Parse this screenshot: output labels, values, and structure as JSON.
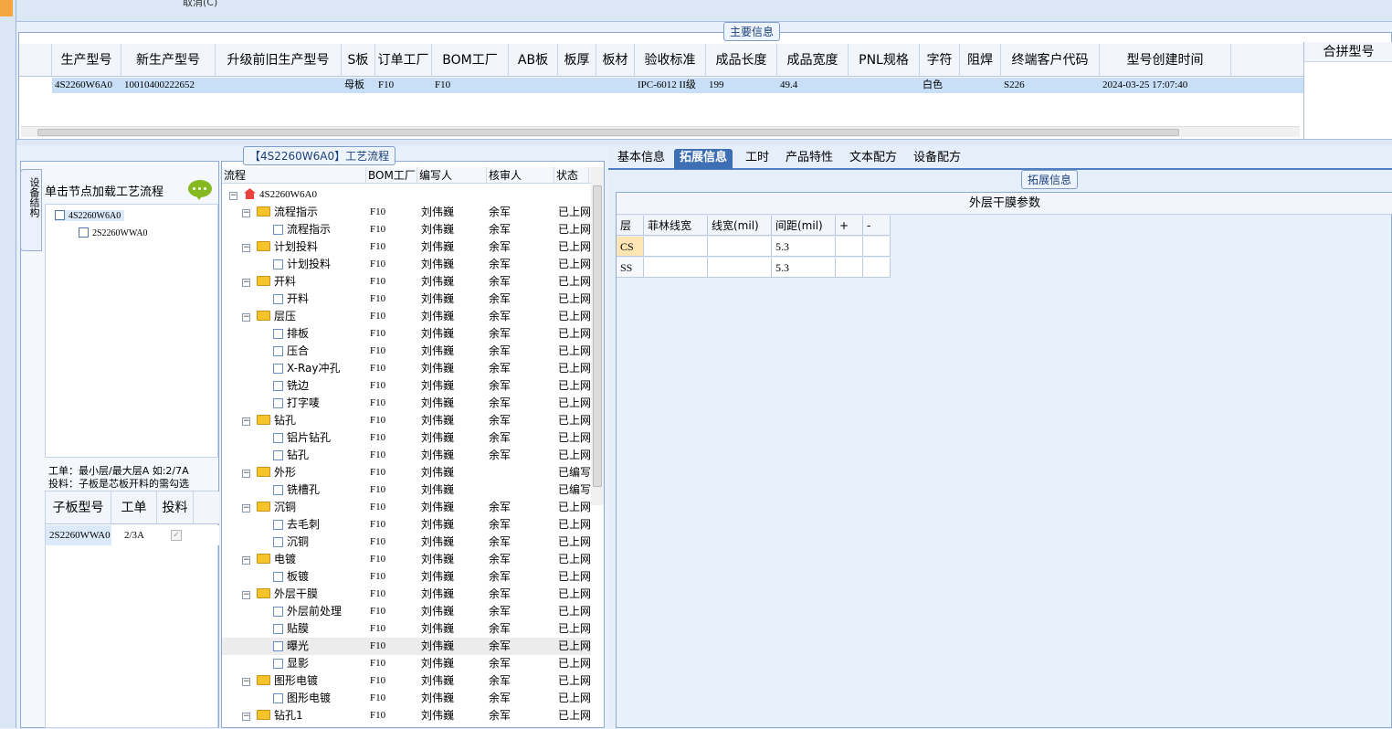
{
  "top": {
    "cancel_label": "取消(C)"
  },
  "main_info": {
    "group_title": "主要信息",
    "columns": [
      "生产型号",
      "新生产型号",
      "升级前旧生产型号",
      "S板",
      "订单工厂",
      "BOM工厂",
      "AB板",
      "板厚",
      "板材",
      "验收标准",
      "成品长度",
      "成品宽度",
      "PNL规格",
      "字符",
      "阻焊",
      "终端客户代码",
      "型号创建时间"
    ],
    "merge_header": "合拼型号",
    "row": [
      "4S2260W6A0",
      "10010400222652",
      "",
      "母板",
      "F10",
      "F10",
      "",
      "",
      "",
      "IPC-6012 II级",
      "199",
      "49.4",
      "",
      "白色",
      "",
      "S226",
      "2024-03-25 17:07:40"
    ]
  },
  "device_panel": {
    "side_tab": "设备结构",
    "hint": "单击节点加载工艺流程",
    "tree": [
      {
        "label": "4S2260W6A0"
      },
      {
        "label": "2S2260WWA0"
      }
    ],
    "note_line1": "工单：最小层/最大层A 如:2/7A",
    "note_line2": "投料：子板是芯板开料的需勾选",
    "sub_columns": [
      "子板型号",
      "工单",
      "投料"
    ],
    "sub_row": {
      "model": "2S2260WWA0",
      "order": "2/3A"
    }
  },
  "flow_panel": {
    "group_title": "【4S2260W6A0】工艺流程",
    "columns": [
      "流程",
      "BOM工厂",
      "编写人",
      "核审人",
      "状态"
    ],
    "root": "4S2260W6A0",
    "rows": [
      {
        "name": "流程指示",
        "type": "folder",
        "bom": "F10",
        "writer": "刘伟巍",
        "reviewer": "余军",
        "status": "已上网"
      },
      {
        "name": "流程指示",
        "type": "leaf",
        "bom": "F10",
        "writer": "刘伟巍",
        "reviewer": "余军",
        "status": "已上网"
      },
      {
        "name": "计划投料",
        "type": "folder",
        "bom": "F10",
        "writer": "刘伟巍",
        "reviewer": "余军",
        "status": "已上网"
      },
      {
        "name": "计划投料",
        "type": "leaf",
        "bom": "F10",
        "writer": "刘伟巍",
        "reviewer": "余军",
        "status": "已上网"
      },
      {
        "name": "开料",
        "type": "folder",
        "bom": "F10",
        "writer": "刘伟巍",
        "reviewer": "余军",
        "status": "已上网"
      },
      {
        "name": "开料",
        "type": "leaf",
        "bom": "F10",
        "writer": "刘伟巍",
        "reviewer": "余军",
        "status": "已上网"
      },
      {
        "name": "层压",
        "type": "folder",
        "bom": "F10",
        "writer": "刘伟巍",
        "reviewer": "余军",
        "status": "已上网"
      },
      {
        "name": "排板",
        "type": "leaf",
        "bom": "F10",
        "writer": "刘伟巍",
        "reviewer": "余军",
        "status": "已上网"
      },
      {
        "name": "压合",
        "type": "leaf",
        "bom": "F10",
        "writer": "刘伟巍",
        "reviewer": "余军",
        "status": "已上网"
      },
      {
        "name": "X-Ray冲孔",
        "type": "leaf",
        "bom": "F10",
        "writer": "刘伟巍",
        "reviewer": "余军",
        "status": "已上网"
      },
      {
        "name": "铣边",
        "type": "leaf",
        "bom": "F10",
        "writer": "刘伟巍",
        "reviewer": "余军",
        "status": "已上网"
      },
      {
        "name": "打字唛",
        "type": "leaf",
        "bom": "F10",
        "writer": "刘伟巍",
        "reviewer": "余军",
        "status": "已上网"
      },
      {
        "name": "钻孔",
        "type": "folder",
        "bom": "F10",
        "writer": "刘伟巍",
        "reviewer": "余军",
        "status": "已上网"
      },
      {
        "name": "铝片钻孔",
        "type": "leaf",
        "bom": "F10",
        "writer": "刘伟巍",
        "reviewer": "余军",
        "status": "已上网"
      },
      {
        "name": "钻孔",
        "type": "leaf",
        "bom": "F10",
        "writer": "刘伟巍",
        "reviewer": "余军",
        "status": "已上网"
      },
      {
        "name": "外形",
        "type": "folder",
        "bom": "F10",
        "writer": "刘伟巍",
        "reviewer": "",
        "status": "已编写"
      },
      {
        "name": "铣槽孔",
        "type": "leaf",
        "bom": "F10",
        "writer": "刘伟巍",
        "reviewer": "",
        "status": "已编写"
      },
      {
        "name": "沉铜",
        "type": "folder",
        "bom": "F10",
        "writer": "刘伟巍",
        "reviewer": "余军",
        "status": "已上网"
      },
      {
        "name": "去毛刺",
        "type": "leaf",
        "bom": "F10",
        "writer": "刘伟巍",
        "reviewer": "余军",
        "status": "已上网"
      },
      {
        "name": "沉铜",
        "type": "leaf",
        "bom": "F10",
        "writer": "刘伟巍",
        "reviewer": "余军",
        "status": "已上网"
      },
      {
        "name": "电镀",
        "type": "folder",
        "bom": "F10",
        "writer": "刘伟巍",
        "reviewer": "余军",
        "status": "已上网"
      },
      {
        "name": "板镀",
        "type": "leaf",
        "bom": "F10",
        "writer": "刘伟巍",
        "reviewer": "余军",
        "status": "已上网"
      },
      {
        "name": "外层干膜",
        "type": "folder",
        "bom": "F10",
        "writer": "刘伟巍",
        "reviewer": "余军",
        "status": "已上网"
      },
      {
        "name": "外层前处理",
        "type": "leaf",
        "bom": "F10",
        "writer": "刘伟巍",
        "reviewer": "余军",
        "status": "已上网"
      },
      {
        "name": "贴膜",
        "type": "leaf",
        "bom": "F10",
        "writer": "刘伟巍",
        "reviewer": "余军",
        "status": "已上网"
      },
      {
        "name": "曝光",
        "type": "leaf",
        "bom": "F10",
        "writer": "刘伟巍",
        "reviewer": "余军",
        "status": "已上网",
        "selected": true
      },
      {
        "name": "显影",
        "type": "leaf",
        "bom": "F10",
        "writer": "刘伟巍",
        "reviewer": "余军",
        "status": "已上网"
      },
      {
        "name": "图形电镀",
        "type": "folder",
        "bom": "F10",
        "writer": "刘伟巍",
        "reviewer": "余军",
        "status": "已上网"
      },
      {
        "name": "图形电镀",
        "type": "leaf",
        "bom": "F10",
        "writer": "刘伟巍",
        "reviewer": "余军",
        "status": "已上网"
      },
      {
        "name": "钻孔1",
        "type": "folder",
        "bom": "F10",
        "writer": "刘伟巍",
        "reviewer": "余军",
        "status": "已上网"
      }
    ]
  },
  "right_panel": {
    "tabs": [
      "基本信息",
      "拓展信息",
      "工时",
      "产品特性",
      "文本配方",
      "设备配方"
    ],
    "active_tab": "拓展信息",
    "group_title": "拓展信息",
    "grid_caption": "外层干膜参数",
    "grid_columns": [
      "层",
      "菲林线宽",
      "线宽(mil)",
      "间距(mil)",
      "+",
      "-"
    ],
    "grid_rows": [
      [
        "CS",
        "",
        "",
        "5.3",
        "",
        ""
      ],
      [
        "SS",
        "",
        "",
        "5.3",
        "",
        ""
      ]
    ]
  }
}
